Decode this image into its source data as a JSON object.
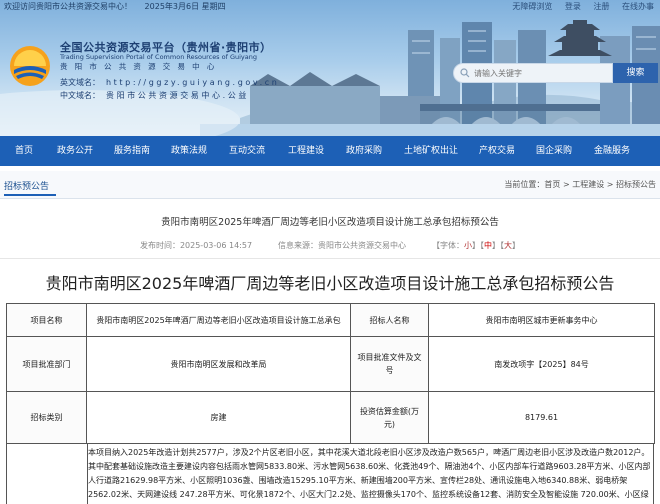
{
  "topbar": {
    "welcome": "欢迎访问贵阳市公共资源交易中心！",
    "date": "2025年3月6日 星期四",
    "links": [
      "无障碍浏览",
      "登录",
      "注册",
      "在线办事"
    ]
  },
  "header": {
    "title_cn": "全国公共资源交易平台（贵州省·贵阳市）",
    "title_en": "Trading Supervision Portal of Common Resources of Guiyang",
    "title_en_cn": "贵 阳 市 公 共 资 源 交 易 中 心",
    "url_label": "英文域名：",
    "url": "http://ggzy.guiyang.gov.cn",
    "domain_label": "中文域名：",
    "domain": "贵阳市公共资源交易中心.公益"
  },
  "search": {
    "placeholder": "请输入关键字",
    "button": "搜索"
  },
  "nav": {
    "items": [
      "首页",
      "政务公开",
      "服务指南",
      "政策法规",
      "互动交流",
      "工程建设",
      "政府采购",
      "土地矿权出让",
      "产权交易",
      "国企采购",
      "金融服务"
    ]
  },
  "breadcrumb": {
    "section": "招标预公告",
    "path": "当前位置：首页 > 工程建设 > 招标预公告"
  },
  "article": {
    "subtitle": "贵阳市南明区2025年啤酒厂周边等老旧小区改造项目设计施工总承包招标预公告",
    "publish": "发布时间：2025-03-06 14:57",
    "source": "信息来源：贵阳市公共资源交易中心",
    "font_label": "【字体：",
    "font_small": "小",
    "font_mid": "中",
    "font_large": "大",
    "font_end": "】",
    "title": "贵阳市南明区2025年啤酒厂周边等老旧小区改造项目设计施工总承包招标预公告"
  },
  "table": {
    "r1": {
      "k1": "项目名称",
      "v1": "贵阳市南明区2025年啤酒厂周边等老旧小区改造项目设计施工总承包",
      "k2": "招标人名称",
      "v2": "贵阳市南明区城市更新事务中心"
    },
    "r2": {
      "k1": "项目批准部门",
      "v1": "贵阳市南明区发展和改革局",
      "k2": "项目批准文件及文号",
      "v2": "南发改项字【2025】84号"
    },
    "r3": {
      "k1": "招标类别",
      "v1": "房建",
      "k2": "投资估算金额(万元)",
      "v2": "8179.61"
    },
    "intro": "本项目纳入2025年改造计划共2577户，涉及2个片区老旧小区，其中花溪大道北段老旧小区涉及改造户数565户，啤酒厂周边老旧小区涉及改造户数2012户。其中配套基础设施改造主要建设内容包括雨水管网5833.80米、污水管网5638.60米、化粪池49个、隔油池4个、小区内部车行道路9603.28平方米、小区内部人行道路21629.98平方米、小区照明1036盏、围墙改造15295.10平方米、新建围墙200平方米、宣传栏28处、通讯设施电入地6340.88米、弱电桥架2562.02米、天网建设线 247.28平方米、可化景1872个、小区大门2.2处、监控摄像头170个、监控系统设备12套、消防安全及智能设施 720.00米、小区绿化"
  }
}
